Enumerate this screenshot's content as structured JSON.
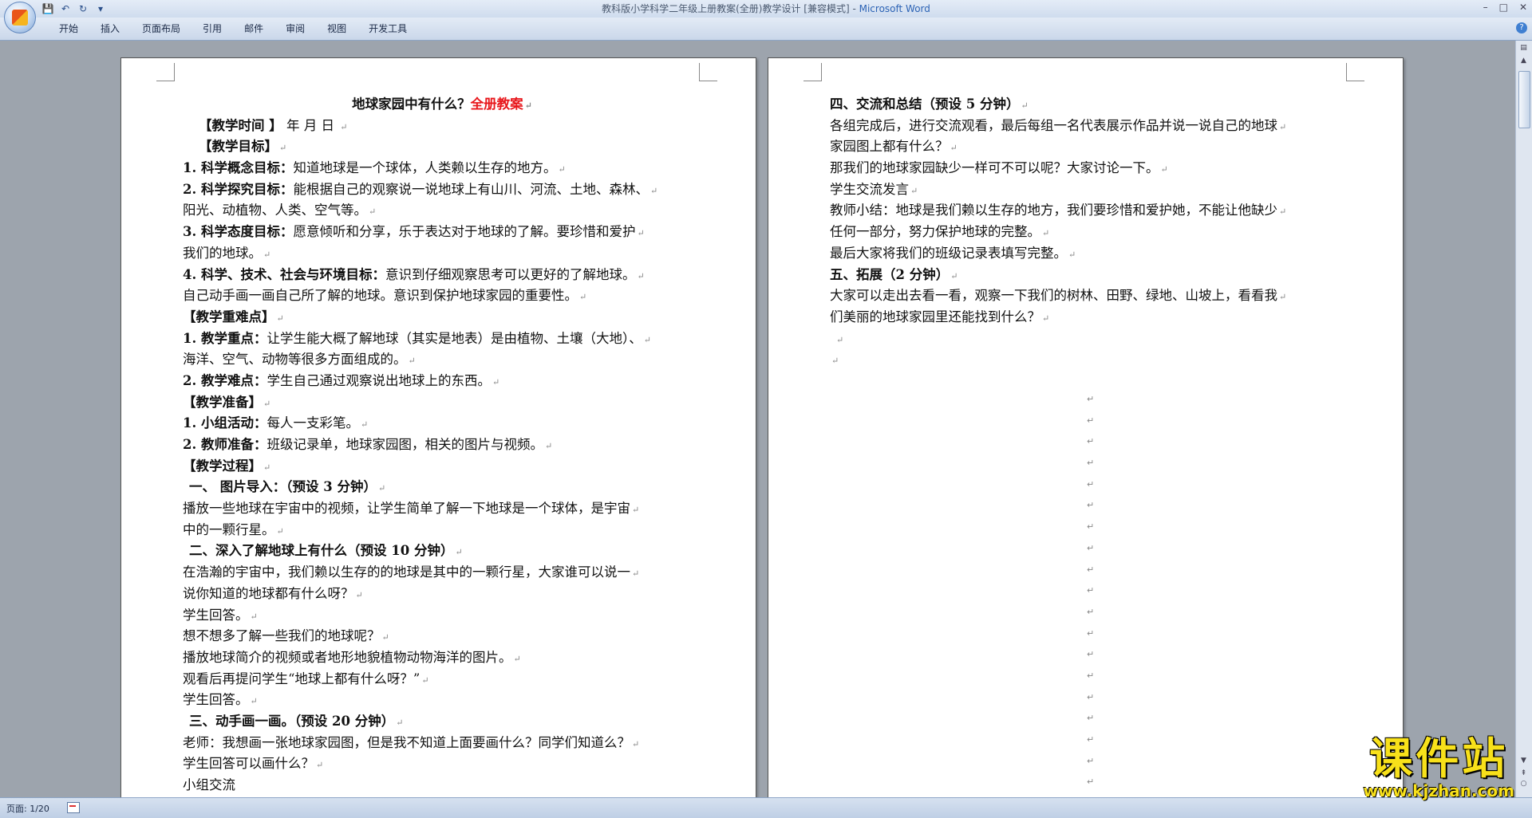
{
  "window": {
    "title": "教科版小学科学二年级上册教案(全册)教学设计 [兼容模式] - ",
    "app_name": "Microsoft Word",
    "controls": {
      "minimize": "–",
      "maximize": "□",
      "close": "✕"
    }
  },
  "quick_access": {
    "save_icon": "💾",
    "undo_icon": "↶",
    "redo_icon": "↻",
    "customize_icon": "▾"
  },
  "ribbon": {
    "tabs": [
      "开始",
      "插入",
      "页面布局",
      "引用",
      "邮件",
      "审阅",
      "视图",
      "开发工具"
    ],
    "help": "?"
  },
  "page1": {
    "title_black": "地球家园中有什么？",
    "title_red": "全册教案",
    "lines": [
      {
        "b": "【教学时间 】",
        "t": "     年    月    日 "
      },
      {
        "b": "【教学目标】",
        "t": ""
      },
      {
        "b": "1. 科学概念目标：",
        "t": "知道地球是一个球体，人类赖以生存的地方。"
      },
      {
        "b": "2. 科学探究目标：",
        "t": "能根据自己的观察说一说地球上有山川、河流、土地、森林、"
      },
      {
        "b": "",
        "t": "阳光、动植物、人类、空气等。"
      },
      {
        "b": "3. 科学态度目标：",
        "t": "愿意倾听和分享，乐于表达对于地球的了解。要珍惜和爱护"
      },
      {
        "b": "",
        "t": "我们的地球。"
      },
      {
        "b": "4. 科学、技术、社会与环境目标：",
        "t": "意识到仔细观察思考可以更好的了解地球。"
      },
      {
        "b": "",
        "t": "自己动手画一画自己所了解的地球。意识到保护地球家园的重要性。"
      },
      {
        "b": "【教学重难点】",
        "t": ""
      },
      {
        "b": "1. 教学重点：",
        "t": "让学生能大概了解地球（其实是地表）是由植物、土壤（大地）、"
      },
      {
        "b": "",
        "t": "海洋、空气、动物等很多方面组成的。"
      },
      {
        "b": "2. 教学难点：",
        "t": "学生自己通过观察说出地球上的东西。"
      },
      {
        "b": "【教学准备】",
        "t": ""
      },
      {
        "b": "1. 小组活动：",
        "t": "每人一支彩笔。"
      },
      {
        "b": "2. 教师准备：",
        "t": "班级记录单，地球家园图，相关的图片与视频。"
      },
      {
        "b": "【教学过程】",
        "t": ""
      },
      {
        "b": "一、 图片导入：（预设 3 分钟）",
        "t": ""
      },
      {
        "b": "",
        "t": "播放一些地球在宇宙中的视频，让学生简单了解一下地球是一个球体，是宇宙"
      },
      {
        "b": "",
        "t": "中的一颗行星。"
      },
      {
        "b": "二、深入了解地球上有什么（预设 10 分钟）",
        "t": ""
      },
      {
        "b": "",
        "t": "在浩瀚的宇宙中，我们赖以生存的的地球是其中的一颗行星，大家谁可以说一"
      },
      {
        "b": "",
        "t": "说你知道的地球都有什么呀？"
      },
      {
        "b": "",
        "t": "学生回答。"
      },
      {
        "b": "",
        "t": "想不想多了解一些我们的地球呢？"
      },
      {
        "b": "",
        "t": "播放地球简介的视频或者地形地貌植物动物海洋的图片。"
      },
      {
        "b": "",
        "t": "观看后再提问学生“地球上都有什么呀？”"
      },
      {
        "b": "",
        "t": "学生回答。"
      },
      {
        "b": "三、动手画一画。（预设 20 分钟）",
        "t": ""
      },
      {
        "b": "",
        "t": "老师：我想画一张地球家园图，但是我不知道上面要画什么？同学们知道么？"
      },
      {
        "b": "",
        "t": "学生回答可以画什么？"
      },
      {
        "b": "",
        "t": "小组交流"
      }
    ]
  },
  "page2": {
    "lines": [
      {
        "b": "四、交流和总结（预设 5 分钟）",
        "t": ""
      },
      {
        "b": "",
        "t": "各组完成后，进行交流观看，最后每组一名代表展示作品并说一说自己的地球"
      },
      {
        "b": "",
        "t": "家园图上都有什么？"
      },
      {
        "b": "",
        "t": "那我们的地球家园缺少一样可不可以呢？大家讨论一下。"
      },
      {
        "b": "",
        "t": "学生交流发言"
      },
      {
        "b": "",
        "t": "教师小结：地球是我们赖以生存的地方，我们要珍惜和爱护她，不能让他缺少"
      },
      {
        "b": "",
        "t": "任何一部分，努力保护地球的完整。"
      },
      {
        "b": "",
        "t": "最后大家将我们的班级记录表填写完整。"
      },
      {
        "b": "五、拓展（2 分钟）",
        "t": ""
      },
      {
        "b": "",
        "t": "大家可以走出去看一看，观察一下我们的树林、田野、绿地、山坡上，看看我"
      },
      {
        "b": "",
        "t": "们美丽的地球家园里还能找到什么？"
      }
    ]
  },
  "paragraph_mark": "↵",
  "status": {
    "page": "页面: 1/20"
  },
  "watermark": {
    "main": "课件站",
    "url": "www.kjzhan.com"
  }
}
